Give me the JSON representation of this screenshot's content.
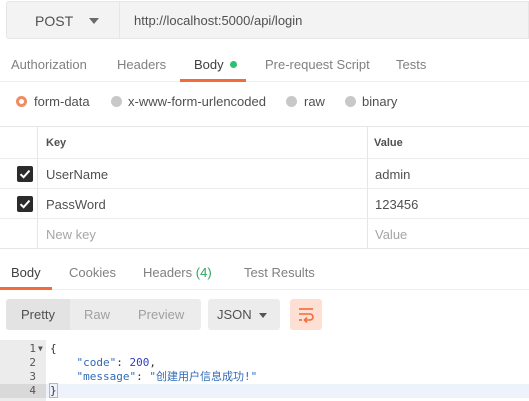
{
  "request": {
    "method": "POST",
    "url": "http://localhost:5000/api/login"
  },
  "request_tabs": [
    {
      "label": "Authorization"
    },
    {
      "label": "Headers"
    },
    {
      "label": "Body",
      "active": true,
      "has_content": true
    },
    {
      "label": "Pre-request Script"
    },
    {
      "label": "Tests"
    }
  ],
  "body_types": [
    {
      "label": "form-data",
      "checked": true
    },
    {
      "label": "x-www-form-urlencoded"
    },
    {
      "label": "raw"
    },
    {
      "label": "binary"
    }
  ],
  "params": {
    "headers": {
      "key": "Key",
      "value": "Value"
    },
    "rows": [
      {
        "checked": true,
        "key": "UserName",
        "value": "admin"
      },
      {
        "checked": true,
        "key": "PassWord",
        "value": "123456"
      }
    ],
    "new_row": {
      "key_placeholder": "New key",
      "value_placeholder": "Value"
    }
  },
  "response_tabs": [
    {
      "label": "Body",
      "active": true
    },
    {
      "label": "Cookies"
    },
    {
      "label": "Headers",
      "count": "(4)"
    },
    {
      "label": "Test Results"
    }
  ],
  "response_toolbar": {
    "views": [
      "Pretty",
      "Raw",
      "Preview"
    ],
    "active_view": "Pretty",
    "format": "JSON",
    "wrap_icon": "wrap-lines-icon"
  },
  "response_body": {
    "lines": [
      {
        "num": "1",
        "text": "{"
      },
      {
        "num": "2",
        "key": "\"code\"",
        "value": "200"
      },
      {
        "num": "3",
        "key": "\"message\"",
        "value": "\"创建用户信息成功!\""
      },
      {
        "num": "4",
        "text": "}"
      }
    ]
  },
  "colors": {
    "accent": "#f26b3a",
    "success": "#2fbf71"
  }
}
